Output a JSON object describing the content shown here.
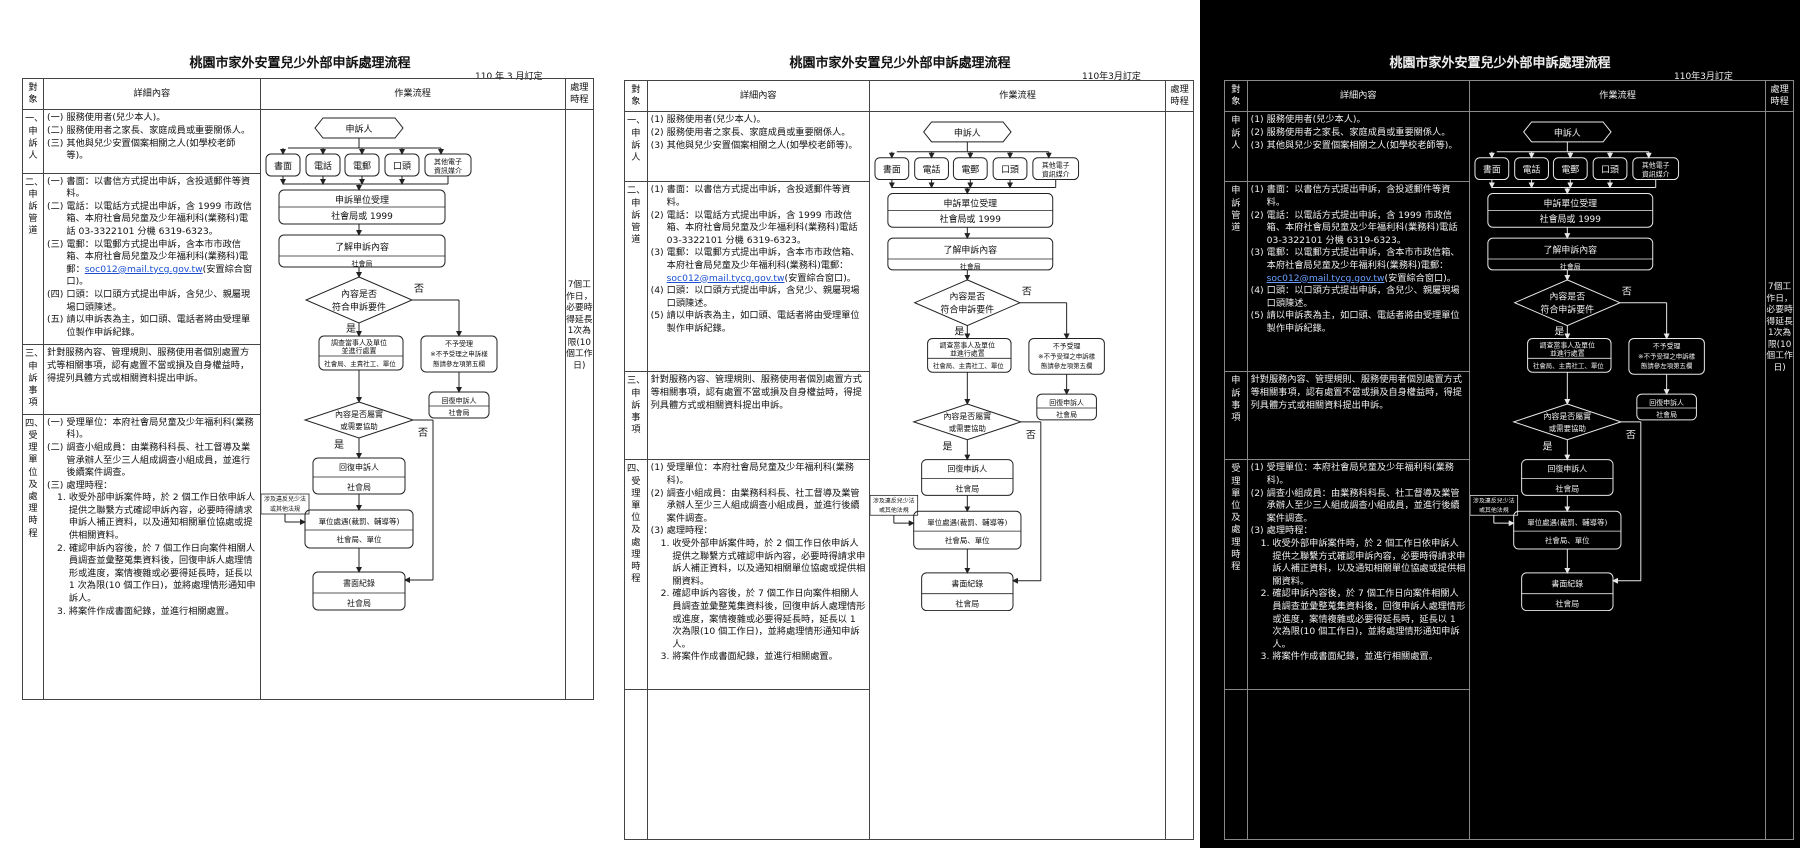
{
  "doc": {
    "title": "桃園市家外安置兒少外部申訴處理流程",
    "revised_1": "110 年 3 月訂定",
    "revised_2": "110年3月訂定",
    "headers": {
      "target": "對象",
      "detail": "詳細內容",
      "flow": "作業流程",
      "time": "處理時程"
    },
    "sections": [
      {
        "label": "一、申訴人",
        "label_alt": "申訴人",
        "items": [
          {
            "num": "(一)",
            "num_alt": "(1)",
            "text": "服務使用者(兒少本人)。"
          },
          {
            "num": "(二)",
            "num_alt": "(2)",
            "text": "服務使用者之家長、家庭成員或重要關係人。"
          },
          {
            "num": "(三)",
            "num_alt": "(3)",
            "text": "其他與兒少安置個案相關之人(如學校老師等)。"
          }
        ]
      },
      {
        "label": "二、申訴管道",
        "label_alt": "申訴管道",
        "items": [
          {
            "num": "(一)",
            "num_alt": "(1)",
            "text": "書面：以書信方式提出申訴，含投遞郵件等資料。"
          },
          {
            "num": "(二)",
            "num_alt": "(2)",
            "text": "電話：以電話方式提出申訴，含 1999 市政信箱、本府社會局兒童及少年福利科(業務科)電話 03-3322101 分機 6319-6323。"
          },
          {
            "num": "(三)",
            "num_alt": "(3)",
            "text_pre": "電郵：以電郵方式提出申訴，含本市市政信箱、本府社會局兒童及少年福利科(業務科)電郵：",
            "email": "soc012@mail.tycg.gov.tw",
            "text_post": "(安置綜合窗口)。"
          },
          {
            "num": "(四)",
            "num_alt": "(4)",
            "text": "口頭：以口頭方式提出申訴，含兒少、親屬現場口頭陳述。"
          },
          {
            "num": "(五)",
            "num_alt": "(5)",
            "text": "請以申訴表為主，如口頭、電話者將由受理單位製作申訴紀錄。"
          }
        ]
      },
      {
        "label": "三、申訴事項",
        "label_alt": "申訴事項",
        "text": "針對服務內容、管理規則、服務使用者個別處置方式等相關事項，認有處置不當或損及自身權益時，得提列具體方式或相關資料提出申訴。"
      },
      {
        "label": "四、受理單位及處理時程",
        "label_alt": "受理單位及處理時程",
        "items": [
          {
            "num": "(一)",
            "num_alt": "(1)",
            "text": "受理單位：本府社會局兒童及少年福利科(業務科)。"
          },
          {
            "num": "(二)",
            "num_alt": "(2)",
            "text": "調查小組成員：由業務科科長、社工督導及業管承辦人至少三人組成調查小組成員，並進行後續案件調查。"
          },
          {
            "num": "(三)",
            "num_alt": "(3)",
            "text": "處理時程："
          }
        ],
        "subitems": [
          {
            "num": "1.",
            "text": "收受外部申訴案件時，於 2 個工作日依申訴人提供之聯繫方式確認申訴內容，必要時得請求申訴人補正資料，以及通知相關單位協處或提供相關資料。"
          },
          {
            "num": "2.",
            "text": "確認申訴內容後，於 7 個工作日向案件相關人員調查並彙整蒐集資料後，回復申訴人處理情形或進度，案情複雜或必要得延長時，延長以 1 次為限(10 個工作日)，並將處理情形通知申訴人。"
          },
          {
            "num": "3.",
            "text": "將案件作成書面紀錄，並進行相關處置。"
          }
        ]
      }
    ],
    "time_note": "7個工作日，必要時得延長1次為限(10個工作日)"
  },
  "flow": {
    "complainant": "申訴人",
    "channels": [
      "書面",
      "電話",
      "電郵",
      "口頭"
    ],
    "channel_other_1": "其他電子",
    "channel_other_2": "資訊媒介",
    "accept_1": "申訴單位受理",
    "accept_2": "社會局或 1999",
    "understand_1": "了解申訴內容",
    "understand_2": "社會局",
    "decision1_1": "內容是否",
    "decision1_2": "符合申訴要件",
    "no": "否",
    "yes": "是",
    "investigate_1": "調查當事人及單位",
    "investigate_2": "並進行處置",
    "investigate_3": "社會局、主責社工、單位",
    "reject_1": "不予受理",
    "reject_2": "※不予受理之申訴樣",
    "reject_3": "態請參左項第五欄",
    "reply_1": "回復申訴人",
    "reply_2": "社會局",
    "decision2_1": "內容是否屬實",
    "decision2_2": "或需要協助",
    "reply2_1": "回復申訴人",
    "reply2_2": "社會局",
    "legal_1": "涉及違反兒少法",
    "legal_2": "或其他法規",
    "unit_1": "單位處遇(裁罰、輔導等)",
    "unit_2": "社會局、單位",
    "record_1": "書面紀錄",
    "record_2": "社會局"
  }
}
